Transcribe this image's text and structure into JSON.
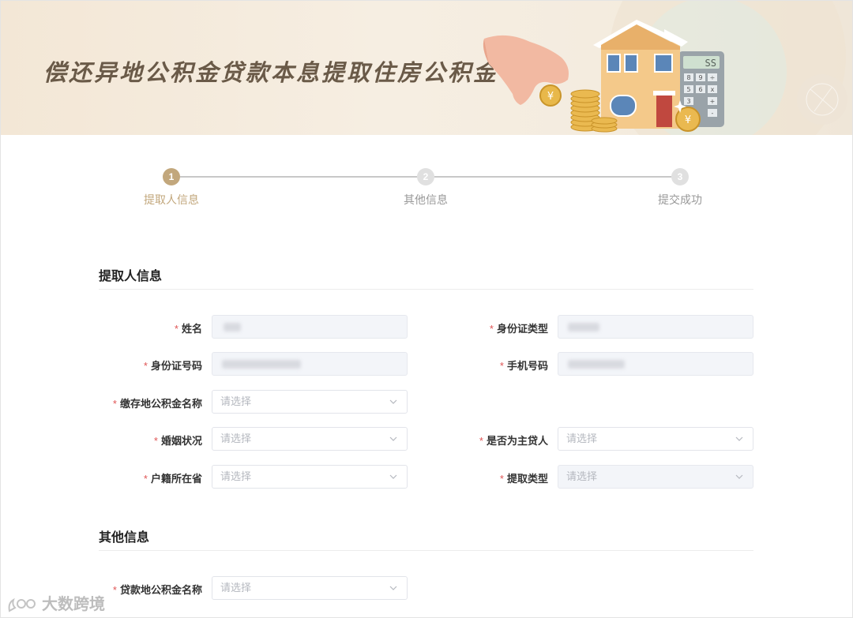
{
  "banner": {
    "title": "偿还异地公积金贷款本息提取住房公积金",
    "calculator_display": "SS",
    "calculator_keys": [
      "8",
      "9",
      "÷",
      "5",
      "6",
      "x",
      "3",
      "+",
      "-"
    ],
    "coin_symbol": "¥"
  },
  "steps": [
    {
      "number": "1",
      "label": "提取人信息",
      "active": true
    },
    {
      "number": "2",
      "label": "其他信息",
      "active": false
    },
    {
      "number": "3",
      "label": "提交成功",
      "active": false
    }
  ],
  "sections": {
    "applicant": {
      "title": "提取人信息"
    },
    "other": {
      "title": "其他信息"
    }
  },
  "form": {
    "required_mark": "*",
    "name": {
      "label": "姓名"
    },
    "id_type": {
      "label": "身份证类型"
    },
    "id_number": {
      "label": "身份证号码"
    },
    "phone": {
      "label": "手机号码"
    },
    "deposit_fund_name": {
      "label": "缴存地公积金名称",
      "placeholder": "请选择"
    },
    "marital_status": {
      "label": "婚姻状况",
      "placeholder": "请选择"
    },
    "is_main_borrower": {
      "label": "是否为主贷人",
      "placeholder": "请选择"
    },
    "household_province": {
      "label": "户籍所在省",
      "placeholder": "请选择"
    },
    "withdrawal_type": {
      "label": "提取类型",
      "placeholder": "请选择"
    },
    "loan_fund_name": {
      "label": "贷款地公积金名称",
      "placeholder": "请选择"
    }
  },
  "watermark": {
    "text": "大数跨境"
  },
  "colors": {
    "accent": "#c2a77c",
    "required": "#e05555",
    "inactive": "#e0e0e0"
  }
}
